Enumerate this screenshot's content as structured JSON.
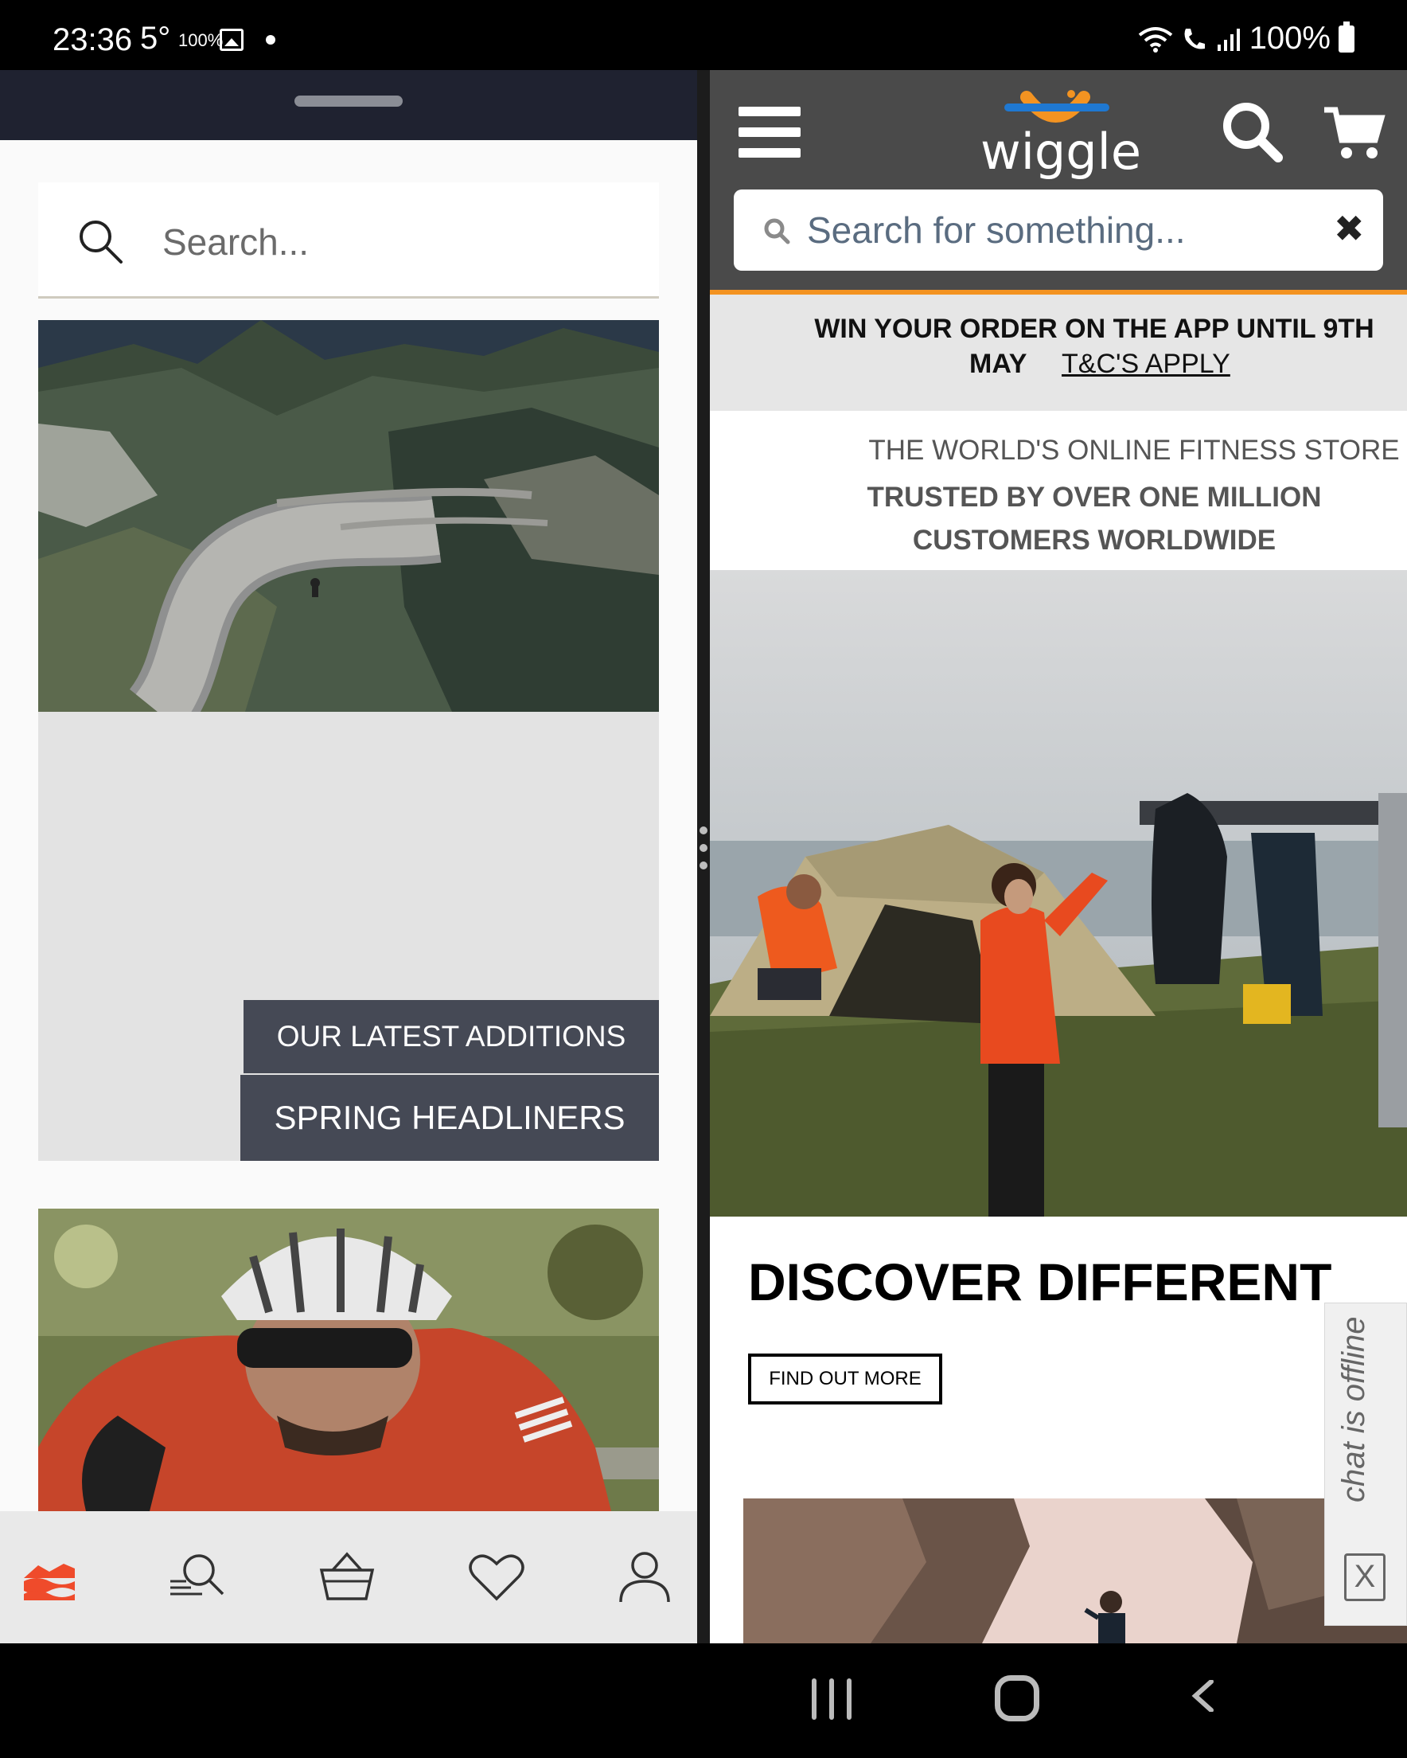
{
  "status_bar": {
    "time": "23:36",
    "temperature": "5°",
    "small_indicator": "100%",
    "battery": "100%"
  },
  "left_app": {
    "search": {
      "placeholder": "Search..."
    },
    "banners": {
      "latest_additions": "OUR LATEST ADDITIONS",
      "spring_headliners": "SPRING HEADLINERS"
    },
    "accent_color": "#ef4b2b",
    "bottom_nav": [
      {
        "icon": "home-waves-icon",
        "active": true
      },
      {
        "icon": "search-icon",
        "active": false
      },
      {
        "icon": "basket-icon",
        "active": false
      },
      {
        "icon": "heart-icon",
        "active": false
      },
      {
        "icon": "user-icon",
        "active": false
      }
    ]
  },
  "right_app": {
    "logo": "wiggle",
    "brand_colors": {
      "orange": "#f39321",
      "blue": "#1f78d1",
      "header": "#4a4a4a"
    },
    "search": {
      "placeholder": "Search for something..."
    },
    "promo": {
      "line1": "WIN YOUR ORDER ON THE APP UNTIL 9TH",
      "line2": "MAY",
      "link": "T&C'S APPLY"
    },
    "tagline": {
      "line1": "THE WORLD'S ONLINE FITNESS STORE",
      "line2": "TRUSTED BY OVER ONE MILLION",
      "line3": "CUSTOMERS WORLDWIDE"
    },
    "feature": {
      "title": "DISCOVER DIFFERENT",
      "cta": "FIND OUT MORE"
    },
    "chat": {
      "status": "chat is offline",
      "close": "X"
    }
  }
}
